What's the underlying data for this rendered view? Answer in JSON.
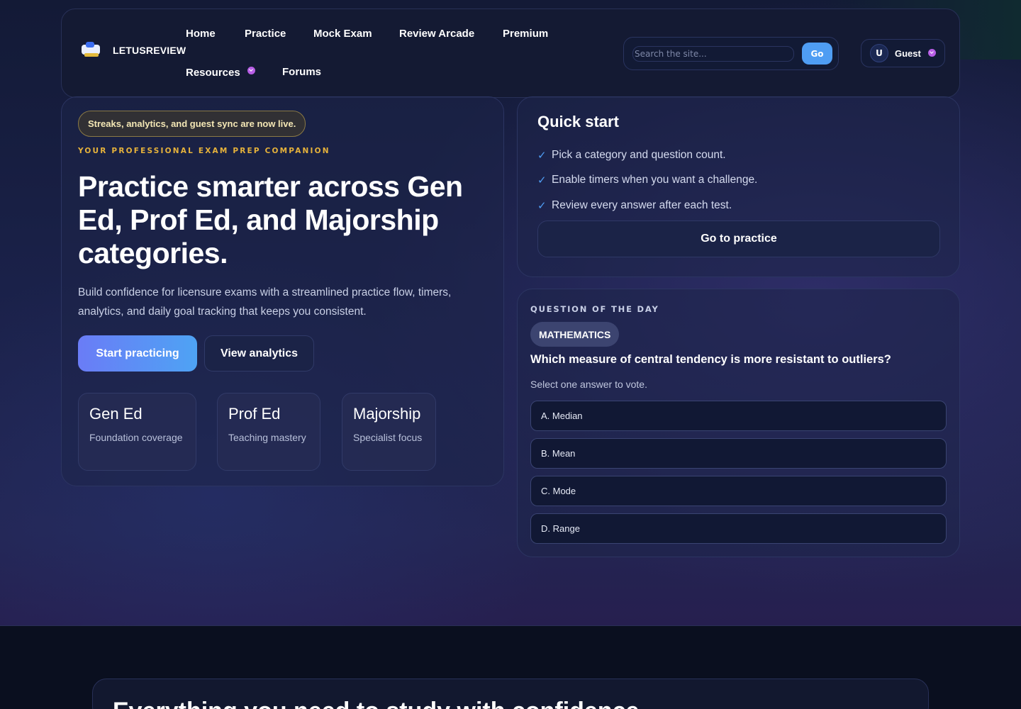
{
  "brand": {
    "name": "LETUSREVIEW"
  },
  "nav": {
    "home": "Home",
    "practice": "Practice",
    "mock_exam": "Mock Exam",
    "review_arcade": "Review Arcade",
    "premium": "Premium",
    "resources": "Resources",
    "forums": "Forums"
  },
  "search": {
    "placeholder": "Search the site...",
    "value": "",
    "button": "Go"
  },
  "user": {
    "initial": "U",
    "name": "Guest"
  },
  "hero": {
    "announcement": "Streaks, analytics, and guest sync are now live.",
    "eyebrow": "YOUR PROFESSIONAL EXAM PREP COMPANION",
    "title": "Practice smarter across Gen Ed, Prof Ed, and Majorship categories.",
    "description": "Build confidence for licensure exams with a streamlined practice flow, timers, analytics, and daily goal tracking that keeps you consistent.",
    "primary_cta": "Start practicing",
    "secondary_cta": "View analytics",
    "categories": [
      {
        "title": "Gen Ed",
        "subtitle": "Foundation coverage"
      },
      {
        "title": "Prof Ed",
        "subtitle": "Teaching mastery"
      },
      {
        "title": "Majorship",
        "subtitle": "Specialist focus"
      }
    ]
  },
  "quick_start": {
    "title": "Quick start",
    "steps": [
      "Pick a category and question count.",
      "Enable timers when you want a challenge.",
      "Review every answer after each test."
    ],
    "check_glyph": "✓",
    "cta": "Go to practice"
  },
  "qotd": {
    "eyebrow": "QUESTION OF THE DAY",
    "subject": "MATHEMATICS",
    "question": "Which measure of central tendency is more resistant to outliers?",
    "hint": "Select one answer to vote.",
    "options": [
      "A. Median",
      "B. Mean",
      "C. Mode",
      "D. Range"
    ]
  },
  "features": {
    "title": "Everything you need to study with confidence"
  },
  "colors": {
    "accent_blue": "#4f9df3",
    "accent_purple": "#b85ee6",
    "eyebrow_gold": "#e6b23b",
    "background": "#0b1022"
  }
}
